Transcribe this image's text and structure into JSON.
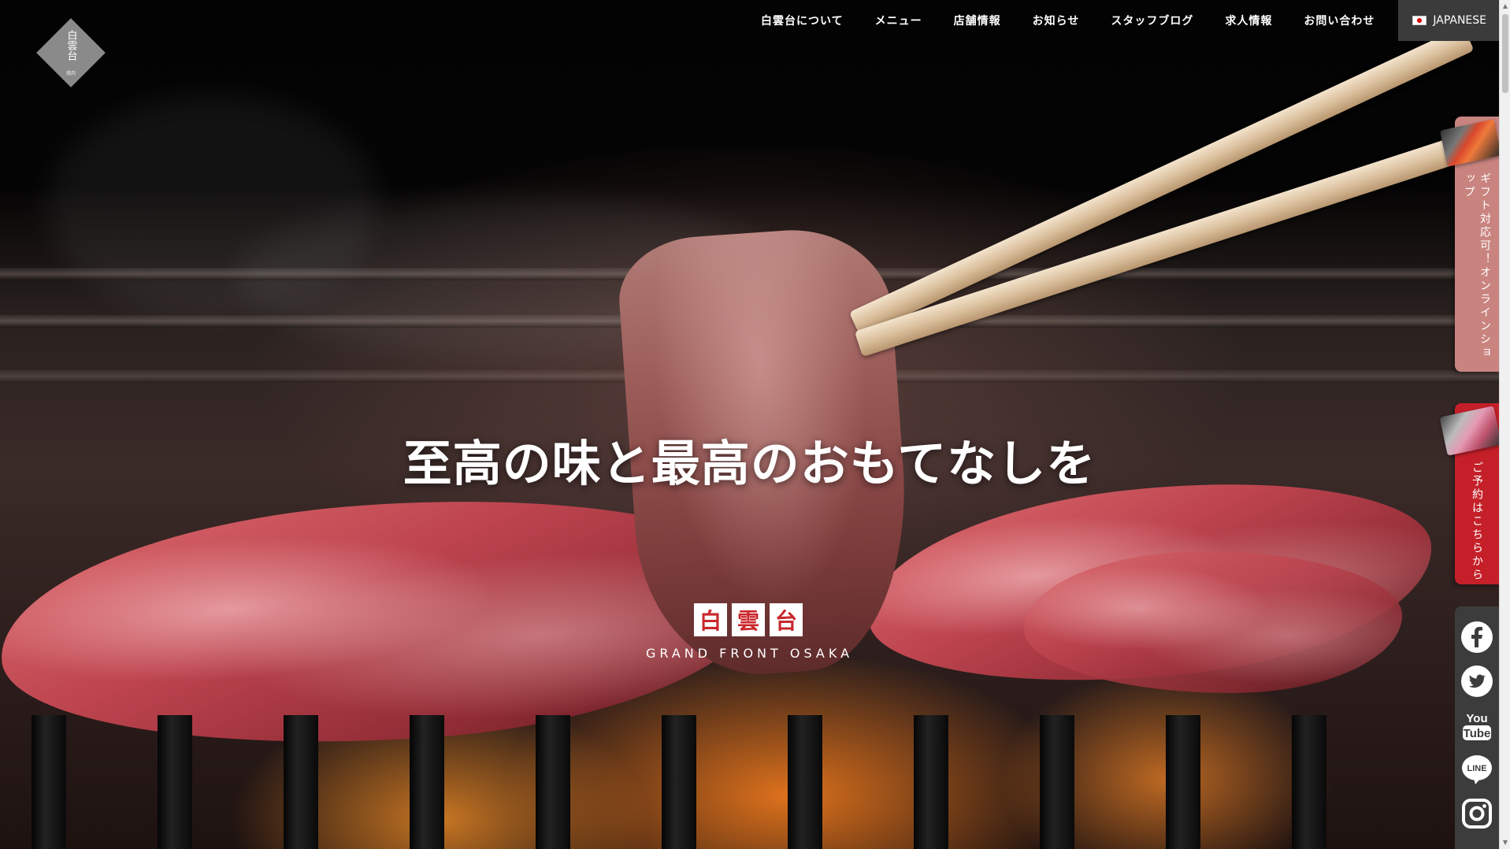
{
  "logo": {
    "kanji": "白雲台",
    "small": "焼肉"
  },
  "nav": {
    "items": [
      {
        "label": "白雲台について"
      },
      {
        "label": "メニュー"
      },
      {
        "label": "店舗情報"
      },
      {
        "label": "お知らせ"
      },
      {
        "label": "スタッフブログ"
      },
      {
        "label": "求人情報"
      },
      {
        "label": "お問い合わせ"
      }
    ],
    "language": "JAPANESE"
  },
  "hero": {
    "headline": "至高の味と最高のおもてなしを",
    "brand_chars": [
      "白",
      "雲",
      "台"
    ],
    "brand_sub": "GRAND FRONT OSAKA"
  },
  "side": {
    "shop_label": "ギフト対応可！オンラインショップ",
    "reserve_label": "ご予約はこちらから",
    "social": [
      {
        "icon": "facebook-icon"
      },
      {
        "icon": "twitter-icon"
      },
      {
        "icon": "youtube-icon",
        "text": "You Tube"
      },
      {
        "icon": "line-icon",
        "text": "LINE"
      },
      {
        "icon": "instagram-icon"
      }
    ]
  },
  "colors": {
    "reserve": "#c52029",
    "shop": "#c9847f",
    "social_bg": "#3c3c3c",
    "lang_bg": "#3b3b3b"
  }
}
